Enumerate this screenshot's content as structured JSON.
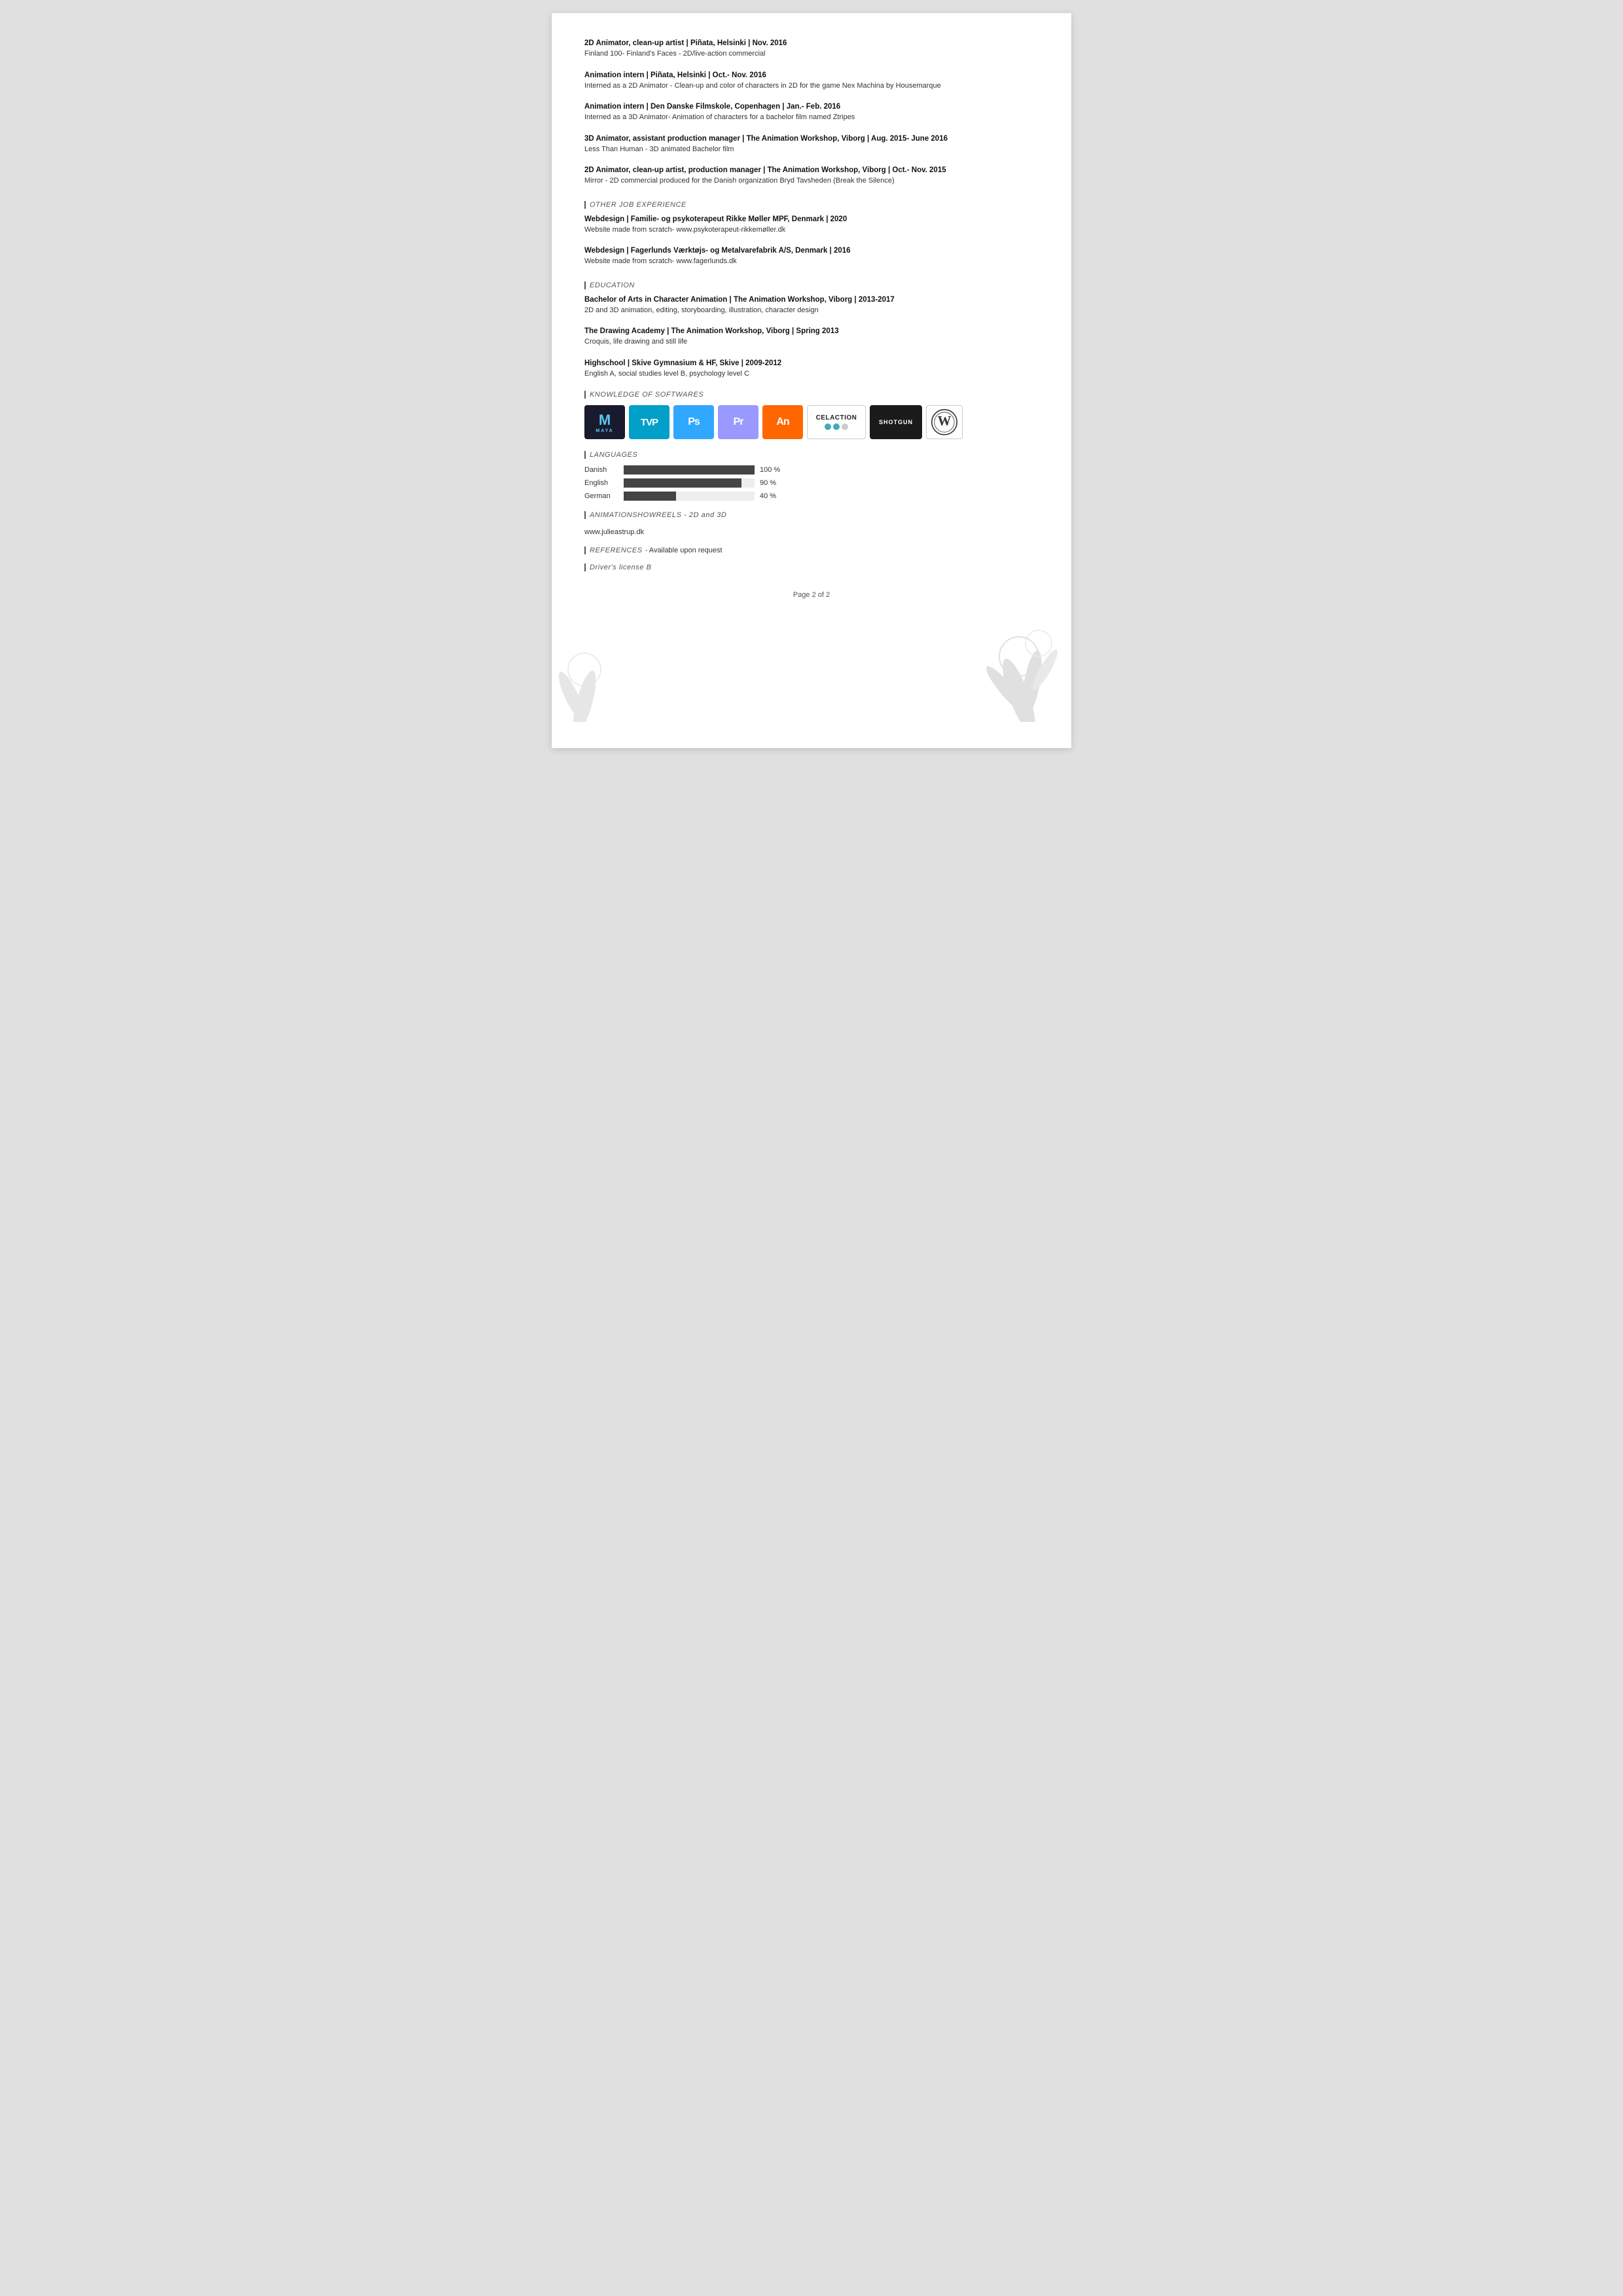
{
  "page": {
    "number": "Page 2 of 2"
  },
  "workExperience": [
    {
      "title": "2D Animator, clean-up artist",
      "location": "Piñata, Helsinki",
      "period": "Nov. 2016",
      "description": "Finland 100- Finland's Faces - 2D/live-action commercial"
    },
    {
      "title": "Animation intern",
      "location": "Piñata, Helsinki",
      "period": "Oct.- Nov. 2016",
      "description": "Interned as a 2D Animator - Clean-up and color of characters in 2D for the game Nex Machina by Housemarque"
    },
    {
      "title": "Animation intern",
      "location": "Den Danske Filmskole, Copenhagen",
      "period": "Jan.- Feb. 2016",
      "description": "Interned as a 3D Animator- Animation of characters for a bachelor film named Ztripes"
    },
    {
      "title": "3D Animator, assistant production manager",
      "location": "The Animation Workshop, Viborg",
      "period": "Aug. 2015- June 2016",
      "description": "Less Than Human - 3D animated Bachelor film"
    },
    {
      "title": "2D Animator, clean-up artist, production manager",
      "location": "The Animation Workshop, Viborg",
      "period": "Oct.- Nov. 2015",
      "description": "Mirror - 2D commercial produced for the Danish organization Bryd Tavsheden (Break the Silence)"
    }
  ],
  "otherJobSection": {
    "label": "OTHER JOB EXPERIENCE"
  },
  "otherJobs": [
    {
      "title": "Webdesign",
      "location": "Familie- og psykoterapeut Rikke Møller MPF, Denmark",
      "period": "2020",
      "description": "Website made from scratch- www.psykoterapeut-rikkemøller.dk"
    },
    {
      "title": "Webdesign",
      "location": "Fagerlunds Værktøjs- og Metalvarefabrik A/S, Denmark",
      "period": "2016",
      "description": "Website made from scratch- www.fagerlunds.dk"
    }
  ],
  "educationSection": {
    "label": "EDUCATION"
  },
  "education": [
    {
      "title": "Bachelor of Arts in Character Animation",
      "location": "The Animation Workshop, Viborg",
      "period": "2013-2017",
      "description": "2D and 3D animation, editing, storyboarding, illustration, character design"
    },
    {
      "title": "The Drawing Academy",
      "location": "The Animation Workshop, Viborg",
      "period": "Spring 2013",
      "description": "Croquis, life drawing and still life"
    },
    {
      "title": "Highschool",
      "location": "Skive Gymnasium & HF, Skive",
      "period": "2009-2012",
      "description": "English A, social studies level B, psychology level C"
    }
  ],
  "softwaresSection": {
    "label": "KNOWLEDGE OF SOFTWARES"
  },
  "softwares": [
    {
      "name": "Maya",
      "type": "maya"
    },
    {
      "name": "TVPaint",
      "type": "tvp"
    },
    {
      "name": "Photoshop",
      "type": "ps"
    },
    {
      "name": "Premiere",
      "type": "pr"
    },
    {
      "name": "Animate",
      "type": "an"
    },
    {
      "name": "CelAction",
      "type": "celaction"
    },
    {
      "name": "Shotgun",
      "type": "shotgun"
    },
    {
      "name": "WordPress",
      "type": "wp"
    }
  ],
  "languagesSection": {
    "label": "LANGUAGES"
  },
  "languages": [
    {
      "name": "Danish",
      "percent": 100,
      "label": "100 %"
    },
    {
      "name": "English",
      "percent": 90,
      "label": "90 %"
    },
    {
      "name": "German",
      "percent": 40,
      "label": "40 %"
    }
  ],
  "showreelsSection": {
    "label": "ANIMATIONSHOWREELS - 2D and 3D"
  },
  "showreelsUrl": "www.julieastrup.dk",
  "referencesSection": {
    "label": "REFERENCES"
  },
  "referencesText": "- Available upon request",
  "driversLicense": {
    "label": "Driver's license B"
  }
}
